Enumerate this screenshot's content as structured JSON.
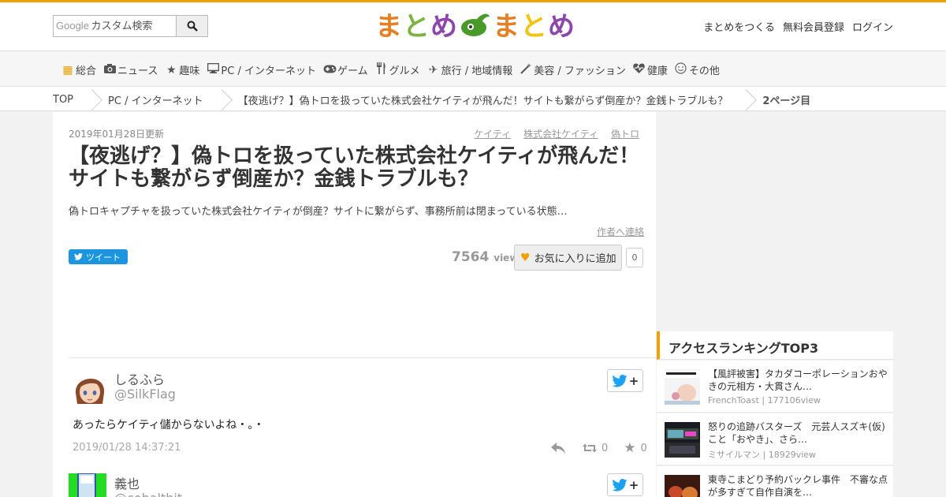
{
  "header": {
    "search_placeholder": "カスタム検索",
    "search_brand": "Google",
    "logo_chars": [
      "ま",
      "と",
      "め",
      "ま",
      "と",
      "め"
    ],
    "logo_colors": [
      "#e67e22",
      "#7cb342",
      "#8e44ad",
      "#e67e22",
      "#f1c40f",
      "#8e44ad"
    ],
    "links": [
      "まとめをつくる",
      "無料会員登録",
      "ログイン"
    ]
  },
  "categories": [
    {
      "icon": "grid-icon",
      "label": "総合"
    },
    {
      "icon": "camera-icon",
      "label": "ニュース"
    },
    {
      "icon": "star-icon",
      "label": "趣味"
    },
    {
      "icon": "monitor-icon",
      "label": "PC / インターネット"
    },
    {
      "icon": "gamepad-icon",
      "label": "ゲーム"
    },
    {
      "icon": "cutlery-icon",
      "label": "グルメ"
    },
    {
      "icon": "plane-icon",
      "label": "旅行 / 地域情報"
    },
    {
      "icon": "wand-icon",
      "label": "美容 / ファッション"
    },
    {
      "icon": "heartbeat-icon",
      "label": "健康"
    },
    {
      "icon": "smile-icon",
      "label": "その他"
    }
  ],
  "breadcrumb": [
    "TOP",
    "PC / インターネット",
    "【夜逃げ？】偽トロを扱っていた株式会社ケイティが飛んだ！サイトも繋がらず倒産か？金銭トラブルも？",
    "2ページ目"
  ],
  "article": {
    "updated": "2019年01月28日更新",
    "tags": [
      "ケイティ",
      "株式会社ケイティ",
      "偽トロ"
    ],
    "title": "【夜逃げ？】偽トロを扱っていた株式会社ケイティが飛んだ！サイトも繋がらず倒産か？金銭トラブルも？",
    "description": "偽トロキャプチャを扱っていた株式会社ケイティが倒産？サイトに繋がらず、事務所前は閉まっている状態…",
    "contact_label": "作者へ連絡",
    "tweet_label": "ツイート",
    "view_count": "7564",
    "view_unit": "view",
    "favorite_label": "お気に入りに追加",
    "favorite_count": "0"
  },
  "tweets": [
    {
      "name": "しるふら",
      "handle": "@SilkFlag",
      "text": "あったらケイティ儲からないよね・。・",
      "time": "2019/01/28 14:37:21",
      "retweets": "0",
      "favorites": "0"
    },
    {
      "name": "義也",
      "handle": "@cobaltbit"
    }
  ],
  "sidebar": {
    "ranking_title": "アクセスランキングTOP3",
    "ranking": [
      {
        "title": "【風評被害】タカダコーポレーションおやきの元相方・大貫さん…",
        "author": "FrenchToast",
        "views": "177106view"
      },
      {
        "title": "怒りの追跡バスターズ　元芸人スズキ(仮)こと「おやき」、さら…",
        "author": "ミサイルマン",
        "views": "18929view"
      },
      {
        "title": "東寺こまどり予約バックレ事件　不審な点が多すぎて自作自演を…",
        "author": "",
        "views": ""
      }
    ]
  }
}
